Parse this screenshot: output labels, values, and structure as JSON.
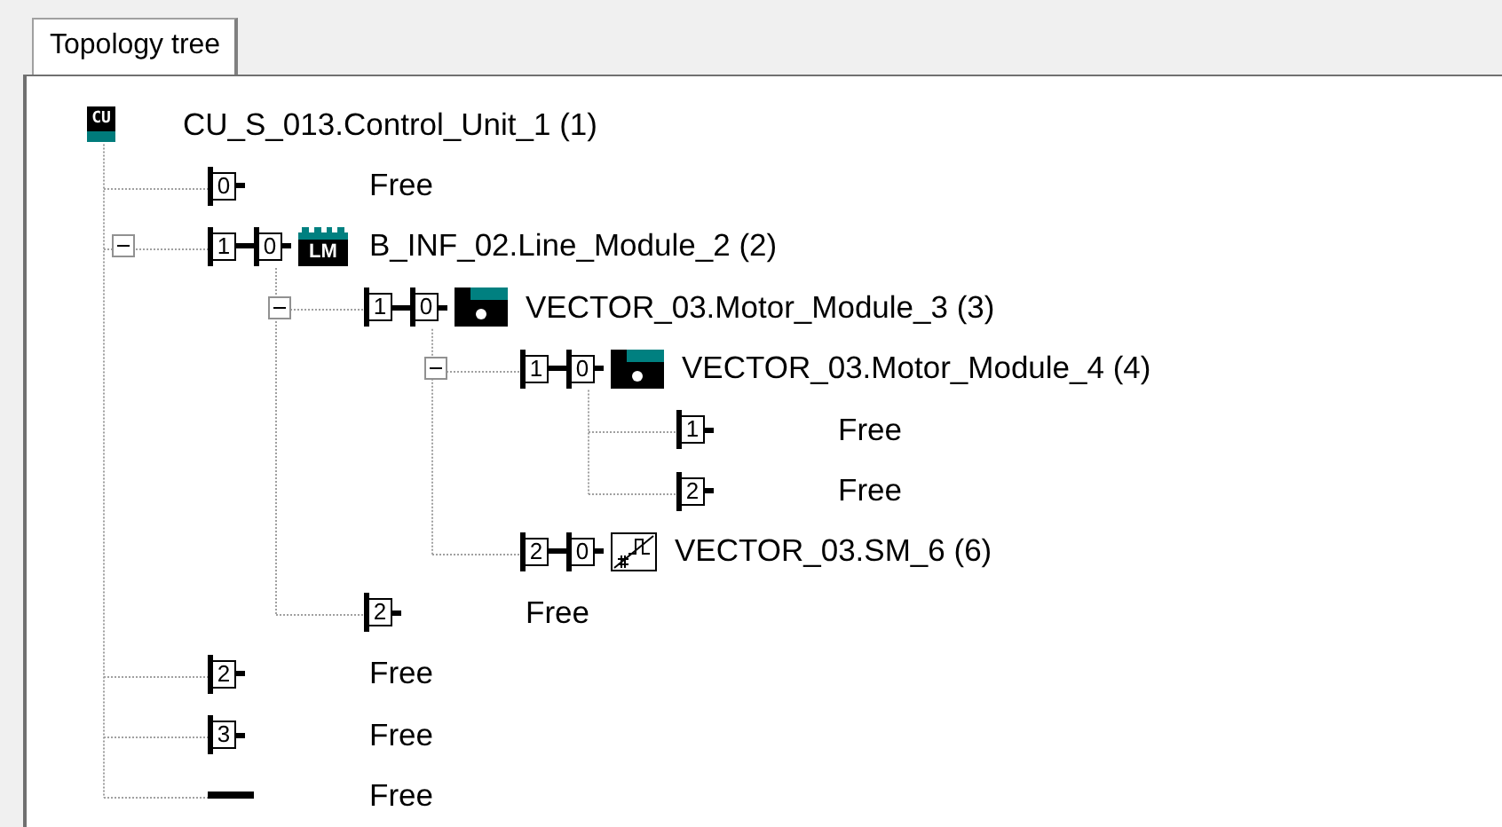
{
  "tabs": [
    {
      "label": "Topology tree",
      "selected": true
    }
  ],
  "tree": {
    "kind": "control-unit",
    "badge": "CU",
    "label": "CU_S_013.Control_Unit_1 (1)",
    "children": [
      {
        "kind": "free-port",
        "ports": [
          "0"
        ],
        "label": "Free"
      },
      {
        "kind": "line-module",
        "ports": [
          "1",
          "0"
        ],
        "badge": "LM",
        "label": "B_INF_02.Line_Module_2 (2)",
        "expanded": true,
        "children": [
          {
            "kind": "motor-module",
            "ports": [
              "1",
              "0"
            ],
            "label": "VECTOR_03.Motor_Module_3 (3)",
            "expanded": true,
            "children": [
              {
                "kind": "motor-module",
                "ports": [
                  "1",
                  "0"
                ],
                "label": "VECTOR_03.Motor_Module_4 (4)",
                "expanded": true,
                "children": [
                  {
                    "kind": "free-port",
                    "ports": [
                      "1"
                    ],
                    "label": "Free"
                  },
                  {
                    "kind": "free-port",
                    "ports": [
                      "2"
                    ],
                    "label": "Free"
                  }
                ]
              },
              {
                "kind": "sensor-module",
                "ports": [
                  "2",
                  "0"
                ],
                "label": "VECTOR_03.SM_6 (6)"
              }
            ]
          },
          {
            "kind": "free-port",
            "ports": [
              "2"
            ],
            "label": "Free"
          }
        ]
      },
      {
        "kind": "free-port",
        "ports": [
          "2"
        ],
        "label": "Free"
      },
      {
        "kind": "free-port",
        "ports": [
          "3"
        ],
        "label": "Free"
      },
      {
        "kind": "free-end",
        "label": "Free"
      }
    ]
  }
}
